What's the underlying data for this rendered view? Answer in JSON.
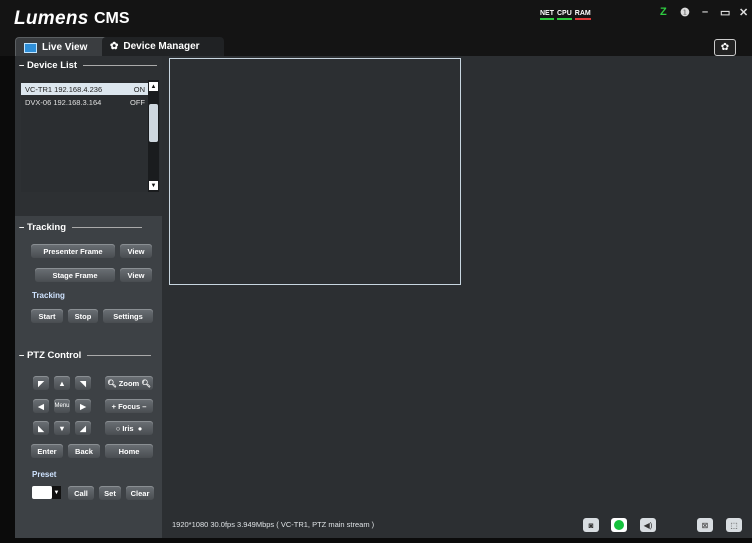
{
  "app": {
    "brand": "Lumens",
    "name": "CMS"
  },
  "meters": {
    "net": "NET",
    "cpu": "CPU",
    "ram": "RAM"
  },
  "window": {
    "z": "Z",
    "info": "❶",
    "minimize": "–",
    "maximize": "▭",
    "close": "✕"
  },
  "tabs": {
    "live_view": "Live View",
    "device_manager": "Device Manager"
  },
  "device_list": {
    "title": "Device List",
    "devices": [
      {
        "name": "VC-TR1 192.168.4.236",
        "status": "ON"
      },
      {
        "name": "DVX-06 192.168.3.164",
        "status": "OFF"
      }
    ]
  },
  "tracking": {
    "title": "Tracking",
    "presenter_frame": "Presenter Frame",
    "stage_frame": "Stage Frame",
    "view": "View",
    "label": "Tracking",
    "start": "Start",
    "stop": "Stop",
    "settings": "Settings"
  },
  "ptz": {
    "title": "PTZ Control",
    "zoom": "Zoom",
    "menu": "Menu",
    "focus": "Focus",
    "iris": "Iris",
    "enter": "Enter",
    "back": "Back",
    "home": "Home"
  },
  "preset": {
    "title": "Preset",
    "call": "Call",
    "set": "Set",
    "clear": "Clear"
  },
  "status": {
    "text": "1920*1080  30.0fps  3.949Mbps  ( VC-TR1, PTZ main stream )"
  },
  "colors": {
    "accent": "#2f8fd8",
    "record": "#16c23d"
  }
}
